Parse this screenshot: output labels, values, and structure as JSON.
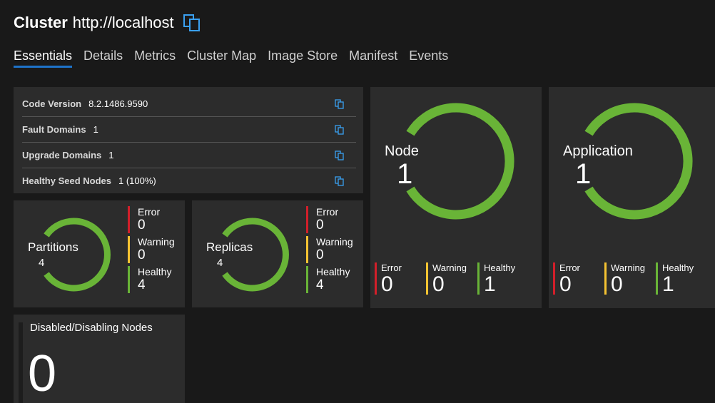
{
  "header": {
    "title": "Cluster",
    "url": "http://localhost"
  },
  "tabs": [
    "Essentials",
    "Details",
    "Metrics",
    "Cluster Map",
    "Image Store",
    "Manifest",
    "Events"
  ],
  "active_tab": "Essentials",
  "essentials": {
    "rows": [
      {
        "label": "Code Version",
        "value": "8.2.1486.9590"
      },
      {
        "label": "Fault Domains",
        "value": "1"
      },
      {
        "label": "Upgrade Domains",
        "value": "1"
      },
      {
        "label": "Healthy Seed Nodes",
        "value": "1 (100%)"
      }
    ]
  },
  "partitions": {
    "label": "Partitions",
    "count": "4",
    "error_label": "Error",
    "error": "0",
    "warning_label": "Warning",
    "warning": "0",
    "healthy_label": "Healthy",
    "healthy": "4"
  },
  "replicas": {
    "label": "Replicas",
    "count": "4",
    "error_label": "Error",
    "error": "0",
    "warning_label": "Warning",
    "warning": "0",
    "healthy_label": "Healthy",
    "healthy": "4"
  },
  "node": {
    "label": "Node",
    "count": "1",
    "error_label": "Error",
    "error": "0",
    "warning_label": "Warning",
    "warning": "0",
    "healthy_label": "Healthy",
    "healthy": "1"
  },
  "application": {
    "label": "Application",
    "count": "1",
    "error_label": "Error",
    "error": "0",
    "warning_label": "Warning",
    "warning": "0",
    "healthy_label": "Healthy",
    "healthy": "1"
  },
  "disabled_nodes": {
    "label": "Disabled/Disabling Nodes",
    "value": "0"
  },
  "colors": {
    "accent": "#1e73c9",
    "copy_icon": "#3aa0f0",
    "healthy": "#69b437",
    "warning": "#f5c332",
    "error": "#d21f2a",
    "panel": "#2c2c2c",
    "background": "#191919"
  },
  "icons": {
    "copy": "copy-icon",
    "ring": "health-ring"
  }
}
